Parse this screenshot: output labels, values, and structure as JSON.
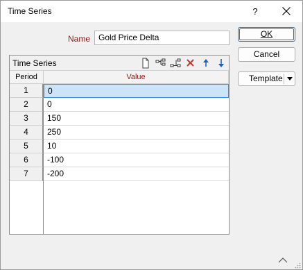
{
  "window": {
    "title": "Time Series",
    "help_label": "?"
  },
  "form": {
    "name_label": "Name",
    "name_value": "Gold Price Delta"
  },
  "buttons": {
    "ok_label": "OK",
    "cancel_label": "Cancel",
    "template_label": "Template"
  },
  "grid": {
    "title": "Time Series",
    "columns": [
      "Period",
      "Value"
    ],
    "rows": [
      {
        "period": "1",
        "value": "0"
      },
      {
        "period": "2",
        "value": "0"
      },
      {
        "period": "3",
        "value": "150"
      },
      {
        "period": "4",
        "value": "250"
      },
      {
        "period": "5",
        "value": "10"
      },
      {
        "period": "6",
        "value": "-100"
      },
      {
        "period": "7",
        "value": "-200"
      }
    ],
    "selected_row": 0,
    "toolbar_icons": [
      "new-icon",
      "insert-icon",
      "append-icon",
      "delete-icon",
      "move-up-icon",
      "move-down-icon"
    ]
  },
  "colors": {
    "accent": "#1f6ed0",
    "label_red": "#8b1a1a",
    "delete_red": "#d93025",
    "arrow_blue": "#1565c0",
    "selection": "#cce4f7"
  }
}
